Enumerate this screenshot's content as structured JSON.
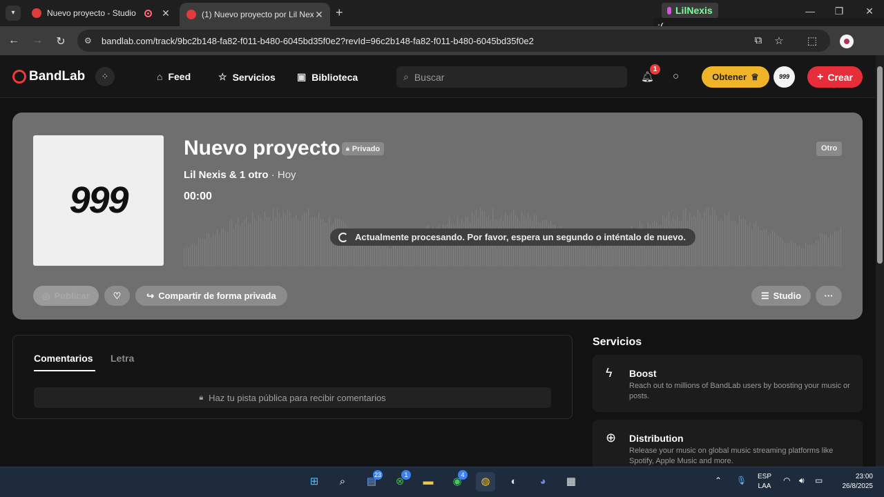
{
  "browser": {
    "tabs": [
      {
        "title": "Nuevo proyecto - Studio"
      },
      {
        "title": "(1) Nuevo proyecto por Lil Nexis"
      }
    ],
    "url": "bandlab.com/track/9bc2b148-fa82-f011-b480-6045bd35f0e2?revId=96c2b148-fa82-f011-b480-6045bd35f0e2"
  },
  "mic_overlay": {
    "name": "LilNexis",
    "message": ":("
  },
  "header": {
    "logo": "BandLab",
    "nav": [
      {
        "label": "Feed",
        "icon": "home-icon"
      },
      {
        "label": "Servicios",
        "icon": "star-icon"
      },
      {
        "label": "Biblioteca",
        "icon": "library-icon"
      }
    ],
    "search_placeholder": "Buscar",
    "notifications_count": "1",
    "obtener_label": "Obtener",
    "avatar_text": "999",
    "crear_label": "Crear"
  },
  "track": {
    "cover_text": "999",
    "title": "Nuevo proyecto",
    "privacy": "Privado",
    "artists": "Lil Nexis & 1 otro",
    "date": "· Hoy",
    "time": "00:00",
    "genre": "Otro",
    "processing_message": "Actualmente procesando. Por favor, espera un segundo o inténtalo de nuevo.",
    "publish_label": "Publicar",
    "share_label": "Compartir de forma privada",
    "studio_label": "Studio"
  },
  "comments": {
    "tabs": [
      "Comentarios",
      "Letra"
    ],
    "hint": "Haz tu pista pública para recibir comentarios"
  },
  "services": {
    "heading": "Servicios",
    "items": [
      {
        "title": "Boost",
        "description": "Reach out to millions of BandLab users by boosting your music or posts.",
        "icon": "lightning-icon"
      },
      {
        "title": "Distribution",
        "description": "Release your music on global music streaming platforms like Spotify, Apple Music and more.",
        "icon": "globe-icon"
      }
    ]
  },
  "taskbar": {
    "badges": {
      "widgets": "23",
      "xbox": "1",
      "whatsapp": "4"
    },
    "language": "ESP",
    "layout": "LAA",
    "time": "23:00",
    "date": "26/8/2025"
  }
}
